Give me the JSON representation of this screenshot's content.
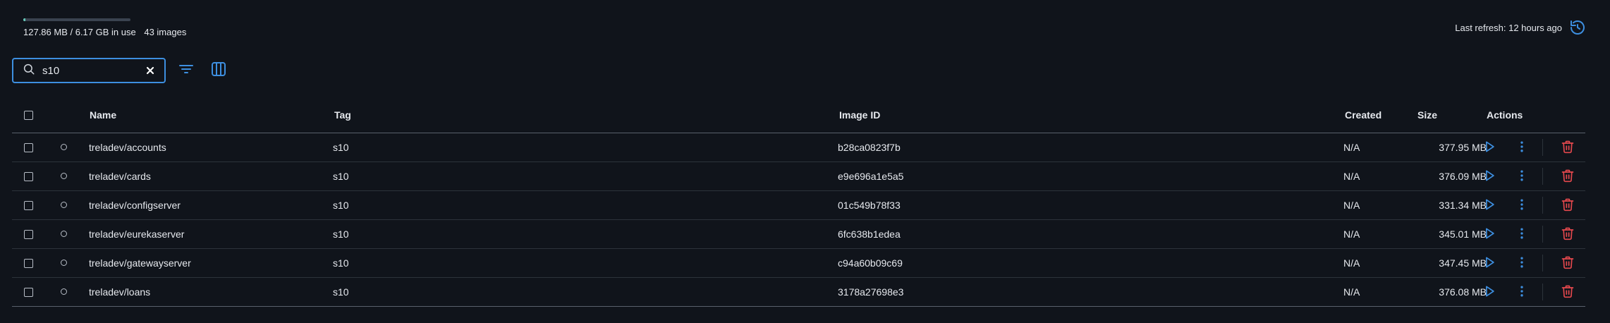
{
  "disk_usage": {
    "used_fraction": 0.0202,
    "text": "127.86 MB / 6.17 GB in use",
    "image_count": "43 images",
    "bar_color": "#64c6b6"
  },
  "refresh": {
    "text": "Last refresh: 12 hours ago",
    "icon": "refresh-icon",
    "color": "#3d8fe0"
  },
  "search": {
    "value": "s10",
    "icon": "search-icon",
    "clear_icon": "close-icon"
  },
  "toolbar": {
    "filter_icon": "filter-icon",
    "columns_icon": "columns-icon"
  },
  "table": {
    "headers": {
      "name": "Name",
      "tag": "Tag",
      "image_id": "Image ID",
      "created": "Created",
      "size": "Size",
      "actions": "Actions"
    },
    "rows": [
      {
        "name": "treladev/accounts",
        "tag": "s10",
        "image_id": "b28ca0823f7b",
        "created": "N/A",
        "size": "377.95 MB"
      },
      {
        "name": "treladev/cards",
        "tag": "s10",
        "image_id": "e9e696a1e5a5",
        "created": "N/A",
        "size": "376.09 MB"
      },
      {
        "name": "treladev/configserver",
        "tag": "s10",
        "image_id": "01c549b78f33",
        "created": "N/A",
        "size": "331.34 MB"
      },
      {
        "name": "treladev/eurekaserver",
        "tag": "s10",
        "image_id": "6fc638b1edea",
        "created": "N/A",
        "size": "345.01 MB"
      },
      {
        "name": "treladev/gatewayserver",
        "tag": "s10",
        "image_id": "c94a60b09c69",
        "created": "N/A",
        "size": "347.45 MB"
      },
      {
        "name": "treladev/loans",
        "tag": "s10",
        "image_id": "3178a27698e3",
        "created": "N/A",
        "size": "376.08 MB"
      }
    ],
    "row_action_icons": [
      "play-icon",
      "more-vertical-icon",
      "trash-icon"
    ]
  },
  "colors": {
    "background": "#10141b",
    "accent": "#3d8fe0",
    "danger": "#e5484d",
    "text": "#e6e9ee"
  }
}
